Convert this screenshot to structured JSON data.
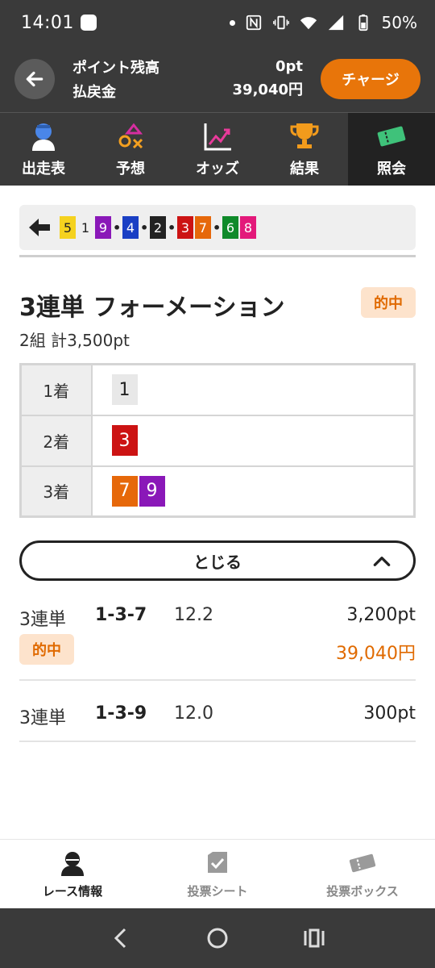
{
  "status_bar": {
    "time": "14:01",
    "battery": "50%"
  },
  "header": {
    "points_label": "ポイント残高",
    "points_value": "0pt",
    "refund_label": "払戻金",
    "refund_value": "39,040円",
    "charge_label": "チャージ"
  },
  "tabs": [
    {
      "label": "出走表",
      "icon": "jockey-icon"
    },
    {
      "label": "予想",
      "icon": "prediction-icon"
    },
    {
      "label": "オッズ",
      "icon": "chart-icon"
    },
    {
      "label": "結果",
      "icon": "trophy-icon"
    },
    {
      "label": "照会",
      "icon": "ticket-icon",
      "active": true
    }
  ],
  "result_strip": {
    "numbers": [
      {
        "n": "5",
        "bg": "#f5d21f",
        "fg": "#222222"
      },
      {
        "n": "1",
        "bg": "#efefef",
        "fg": "#222222"
      },
      {
        "n": "9",
        "bg": "#8a18b8",
        "fg": "#ffffff"
      },
      {
        "n": "4",
        "bg": "#1a3fc4",
        "fg": "#ffffff"
      },
      {
        "n": "2",
        "bg": "#222222",
        "fg": "#ffffff"
      },
      {
        "n": "3",
        "bg": "#cc1313",
        "fg": "#ffffff"
      },
      {
        "n": "7",
        "bg": "#e6680a",
        "fg": "#ffffff"
      },
      {
        "n": "6",
        "bg": "#0f8a2a",
        "fg": "#ffffff"
      },
      {
        "n": "8",
        "bg": "#e3197a",
        "fg": "#ffffff"
      }
    ],
    "separators_after": [
      2,
      3,
      4,
      6
    ]
  },
  "bet": {
    "title": "3連単 フォーメーション",
    "hit_label": "的中",
    "summary": "2組 計3,500pt",
    "rows": [
      {
        "label": "1着",
        "numbers": [
          {
            "n": "1",
            "bg": "#e8e8e8",
            "fg": "#222222"
          }
        ]
      },
      {
        "label": "2着",
        "numbers": [
          {
            "n": "3",
            "bg": "#cc1313",
            "fg": "#ffffff"
          }
        ]
      },
      {
        "label": "3着",
        "numbers": [
          {
            "n": "7",
            "bg": "#e6680a",
            "fg": "#ffffff"
          },
          {
            "n": "9",
            "bg": "#8a18b8",
            "fg": "#ffffff"
          }
        ]
      }
    ],
    "close_label": "とじる"
  },
  "tickets": [
    {
      "type": "3連単",
      "combo": "1-3-7",
      "odds": "12.2",
      "amount": "3,200pt",
      "hit": "的中",
      "payout": "39,040円"
    },
    {
      "type": "3連単",
      "combo": "1-3-9",
      "odds": "12.0",
      "amount": "300pt"
    }
  ],
  "bottom_nav": [
    {
      "label": "レース情報",
      "icon": "jockey-icon",
      "active": true
    },
    {
      "label": "投票シート",
      "icon": "check-sheet-icon"
    },
    {
      "label": "投票ボックス",
      "icon": "ticket-icon"
    }
  ],
  "colors": {
    "accent": "#e8750a",
    "hit_text": "#e06a00",
    "hit_bg": "#fde3cc",
    "dark": "#3a3a3a"
  }
}
